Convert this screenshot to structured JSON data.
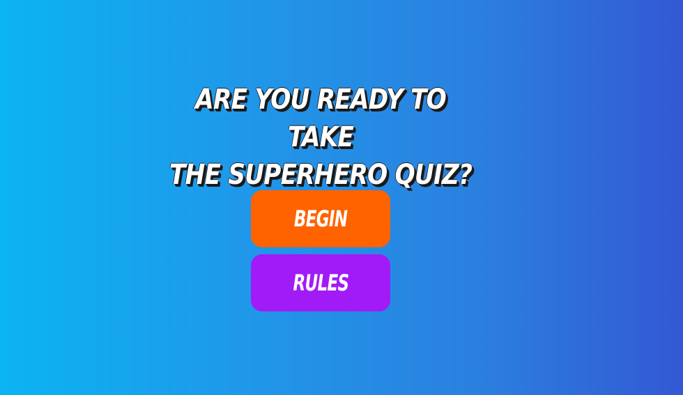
{
  "quiz": {
    "title_line1": "ARE YOU READY TO TAKE",
    "title_line2": "THE SUPERHERO QUIZ?",
    "begin_label": "BEGIN",
    "rules_label": "RULES"
  },
  "colors": {
    "background_start": "#0bb4f2",
    "background_end": "#3358d4",
    "begin_button": "#ff6300",
    "rules_button": "#a11bf7",
    "text": "#ffffff"
  }
}
